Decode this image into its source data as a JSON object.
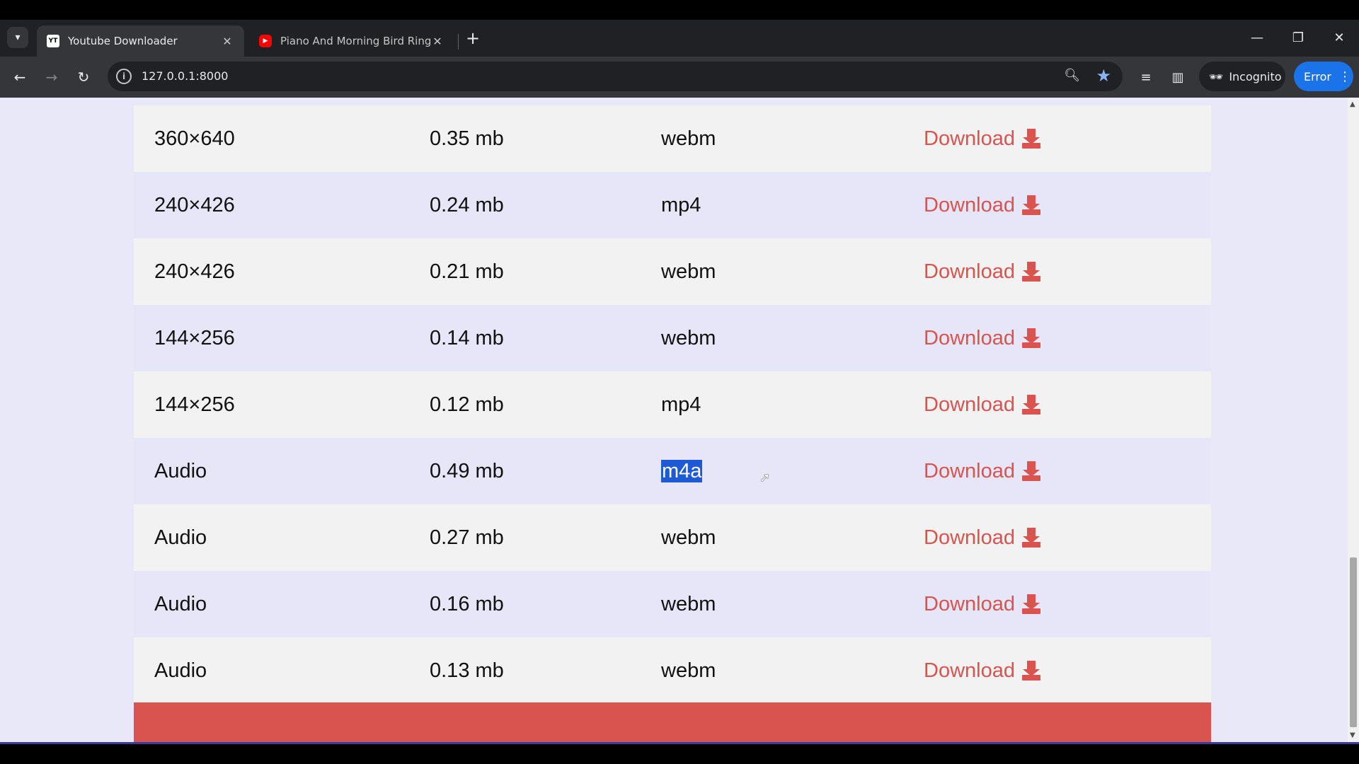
{
  "browser": {
    "tabs": [
      {
        "title": "Youtube Downloader",
        "favicon": "YT",
        "active": true
      },
      {
        "title": "Piano And Morning Bird Ringto",
        "favicon": "youtube-icon",
        "active": false
      }
    ],
    "url": "127.0.0.1:8000",
    "incognito_label": "Incognito",
    "error_label": "Error"
  },
  "table": {
    "download_label": "Download",
    "rows": [
      {
        "quality": "360×640",
        "size": "0.35 mb",
        "format": "webm"
      },
      {
        "quality": "240×426",
        "size": "0.24 mb",
        "format": "mp4"
      },
      {
        "quality": "240×426",
        "size": "0.21 mb",
        "format": "webm"
      },
      {
        "quality": "144×256",
        "size": "0.14 mb",
        "format": "webm"
      },
      {
        "quality": "144×256",
        "size": "0.12 mb",
        "format": "mp4"
      },
      {
        "quality": "Audio",
        "size": "0.49 mb",
        "format": "m4a",
        "selected": true
      },
      {
        "quality": "Audio",
        "size": "0.27 mb",
        "format": "webm"
      },
      {
        "quality": "Audio",
        "size": "0.16 mb",
        "format": "webm"
      },
      {
        "quality": "Audio",
        "size": "0.13 mb",
        "format": "webm"
      }
    ]
  },
  "colors": {
    "accent": "#d9534f",
    "selection": "#1e5ad6",
    "row_odd": "#f2f2f2",
    "row_even": "#e6e6f8"
  }
}
